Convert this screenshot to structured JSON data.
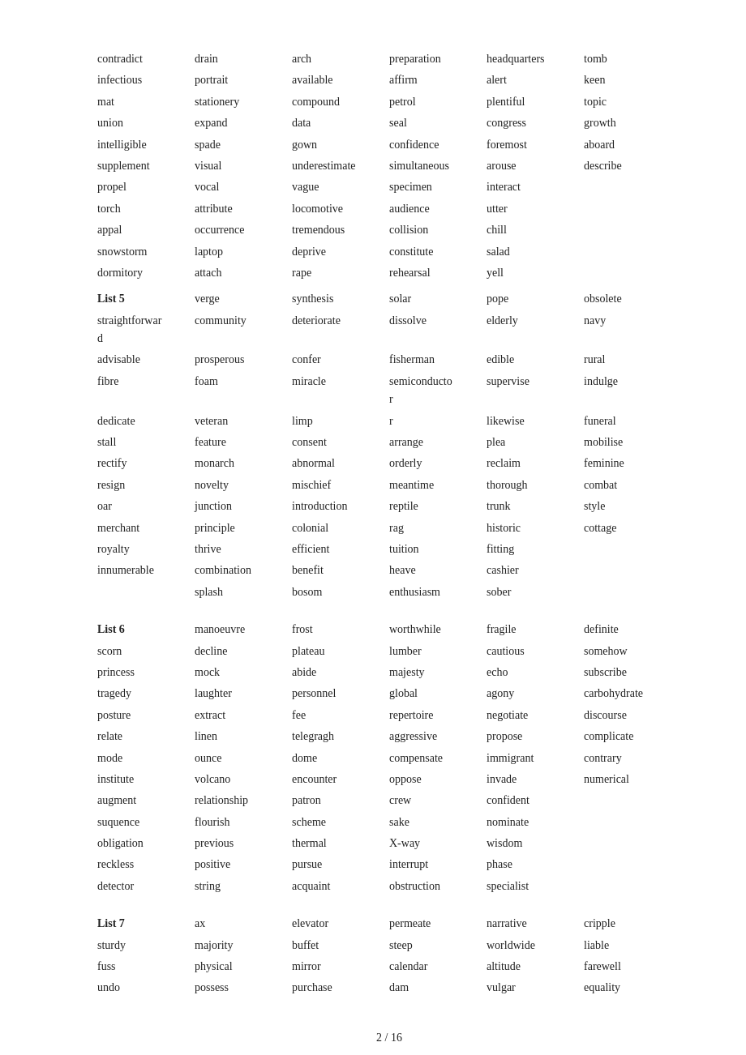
{
  "page": {
    "number": "2 / 16"
  },
  "continuation": {
    "rows": [
      [
        "contradict",
        "drain",
        "arch",
        "preparation",
        "headquarters",
        "tomb"
      ],
      [
        "infectious",
        "portrait",
        "available",
        "affirm",
        "alert",
        "keen"
      ],
      [
        "mat",
        "stationery",
        "compound",
        "petrol",
        "plentiful",
        "topic"
      ],
      [
        "union",
        "expand",
        "data",
        "seal",
        "congress",
        "growth"
      ],
      [
        "intelligible",
        "spade",
        "gown",
        "confidence",
        "foremost",
        "aboard"
      ],
      [
        "supplement",
        "visual",
        "underestimate",
        "simultaneous",
        "arouse",
        "describe"
      ],
      [
        "propel",
        "vocal",
        "vague",
        "specimen",
        "interact",
        ""
      ],
      [
        "torch",
        "attribute",
        "locomotive",
        "audience",
        "utter",
        ""
      ],
      [
        "appal",
        "occurrence",
        "tremendous",
        "collision",
        "chill",
        ""
      ],
      [
        "snowstorm",
        "laptop",
        "deprive",
        "constitute",
        "salad",
        ""
      ],
      [
        "dormitory",
        "attach",
        "rape",
        "rehearsal",
        "yell",
        ""
      ]
    ]
  },
  "list5": {
    "label": "List 5",
    "rows": [
      [
        "",
        "verge",
        "synthesis",
        "solar",
        "pope",
        "obsolete"
      ],
      [
        "straightforward",
        "community",
        "deteriorate",
        "dissolve",
        "elderly",
        "navy"
      ],
      [
        "advisable",
        "prosperous",
        "confer",
        "fisherman",
        "edible",
        "rural"
      ],
      [
        "fibre",
        "foam",
        "miracle",
        "semiconductor",
        "supervise",
        "indulge"
      ],
      [
        "dedicate",
        "veteran",
        "limp",
        "r",
        "likewise",
        "funeral"
      ],
      [
        "stall",
        "feature",
        "consent",
        "arrange",
        "plea",
        "mobilise"
      ],
      [
        "rectify",
        "monarch",
        "abnormal",
        "orderly",
        "reclaim",
        "feminine"
      ],
      [
        "resign",
        "novelty",
        "mischief",
        "meantime",
        "thorough",
        "combat"
      ],
      [
        "oar",
        "junction",
        "introduction",
        "reptile",
        "trunk",
        "style"
      ],
      [
        "merchant",
        "principle",
        "colonial",
        "rag",
        "historic",
        "cottage"
      ],
      [
        "royalty",
        "thrive",
        "efficient",
        "tuition",
        "fitting",
        ""
      ],
      [
        "innumerable",
        "combination",
        "benefit",
        "heave",
        "cashier",
        ""
      ],
      [
        "",
        "splash",
        "bosom",
        "enthusiasm",
        "sober",
        ""
      ]
    ]
  },
  "list6": {
    "label": "List 6",
    "rows": [
      [
        "",
        "manoeuvre",
        "frost",
        "worthwhile",
        "fragile",
        "definite"
      ],
      [
        "scorn",
        "decline",
        "plateau",
        "lumber",
        "cautious",
        "somehow"
      ],
      [
        "princess",
        "mock",
        "abide",
        "majesty",
        "echo",
        "subscribe"
      ],
      [
        "tragedy",
        "laughter",
        "personnel",
        "global",
        "agony",
        "carbohydrate"
      ],
      [
        "posture",
        "extract",
        "fee",
        "repertoire",
        "negotiate",
        "discourse"
      ],
      [
        "relate",
        "linen",
        "telegragh",
        "aggressive",
        "propose",
        "complicate"
      ],
      [
        "mode",
        "ounce",
        "dome",
        "compensate",
        "immigrant",
        "contrary"
      ],
      [
        "institute",
        "volcano",
        "encounter",
        "oppose",
        "invade",
        "numerical"
      ],
      [
        "augment",
        "relationship",
        "patron",
        "crew",
        "confident",
        ""
      ],
      [
        "suquence",
        "flourish",
        "scheme",
        "sake",
        "nominate",
        ""
      ],
      [
        "obligation",
        "previous",
        "thermal",
        "X-way",
        "wisdom",
        ""
      ],
      [
        "reckless",
        "positive",
        "pursue",
        "interrupt",
        "phase",
        ""
      ],
      [
        "detector",
        "string",
        "acquaint",
        "obstruction",
        "specialist",
        ""
      ]
    ]
  },
  "list7": {
    "label": "List 7",
    "rows": [
      [
        "",
        "ax",
        "elevator",
        "permeate",
        "narrative",
        "cripple"
      ],
      [
        "sturdy",
        "majority",
        "buffet",
        "steep",
        "worldwide",
        "liable"
      ],
      [
        "fuss",
        "physical",
        "mirror",
        "calendar",
        "altitude",
        "farewell"
      ],
      [
        "undo",
        "possess",
        "purchase",
        "dam",
        "vulgar",
        "equality"
      ]
    ]
  }
}
